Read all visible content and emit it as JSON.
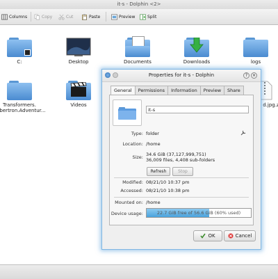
{
  "window": {
    "title": "it-s - Dolphin <2>"
  },
  "toolbar": {
    "columns": "Columns",
    "copy": "Copy",
    "cut": "Cut",
    "paste": "Paste",
    "preview": "Preview",
    "split": "Split"
  },
  "items": [
    {
      "label": "C:",
      "icon": "folder-icon"
    },
    {
      "label": "Desktop",
      "icon": "desktop-icon"
    },
    {
      "label": "Documents",
      "icon": "documents-folder-icon"
    },
    {
      "label": "Downloads",
      "icon": "downloads-folder-icon"
    },
    {
      "label": "logs",
      "icon": "folder-icon"
    },
    {
      "label": "Transformers.\nCybertron.Adventur...",
      "icon": "folder-icon"
    },
    {
      "label": "Videos",
      "icon": "videos-folder-icon"
    },
    {
      "label": "d.jpg.zip",
      "icon": "zip-file-icon"
    }
  ],
  "dialog": {
    "title": "Properties for it-s - Dolphin",
    "tabs": [
      "General",
      "Permissions",
      "Information",
      "Preview",
      "Share"
    ],
    "active_tab": "General",
    "name_value": "it-s",
    "type_label": "Type:",
    "type_value": "folder",
    "location_label": "Location:",
    "location_value": "/home",
    "size_label": "Size:",
    "size_value": "34.6 GiB (37,127,999,751)",
    "size_detail": "36,009 files, 4,408 sub-folders",
    "refresh_label": "Refresh",
    "stop_label": "Stop",
    "modified_label": "Modified:",
    "modified_value": "08/21/10 10:37 pm",
    "accessed_label": "Accessed:",
    "accessed_value": "08/21/10 10:38 pm",
    "mounted_label": "Mounted on:",
    "mounted_value": "/home",
    "usage_label": "Device usage:",
    "usage_text": "22.7 GiB free of 56.6 GiB (60% used)",
    "usage_percent": 60,
    "ok_label": "OK",
    "cancel_label": "Cancel"
  },
  "colors": {
    "accent": "#4aa2dc",
    "folder": "#5b9be0",
    "dialog_border": "#7fb6e2"
  }
}
